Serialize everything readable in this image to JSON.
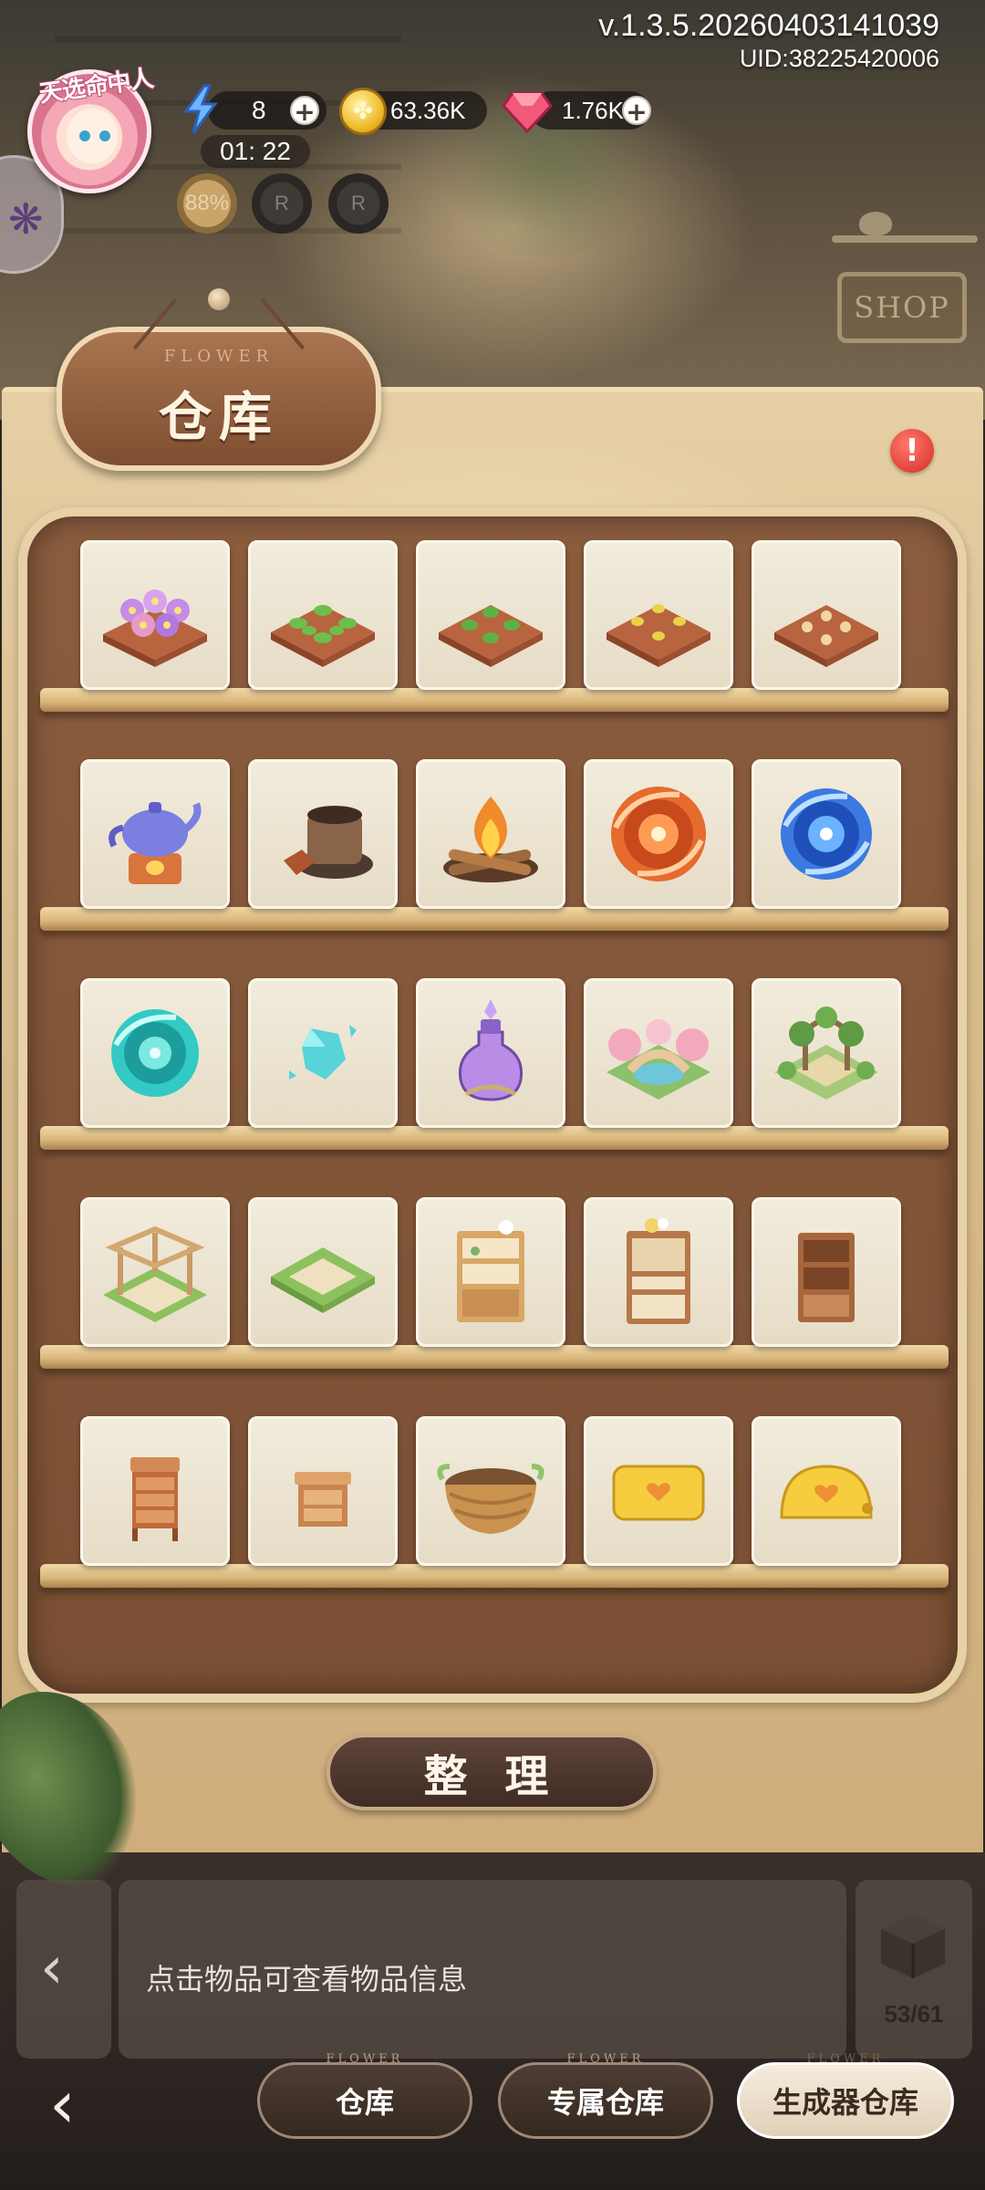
{
  "header": {
    "version": "v.1.3.5.20260403141039",
    "uid": "UID:38225420006",
    "avatar_badge": "天选命中人"
  },
  "resources": {
    "energy": "8",
    "energy_timer": "01: 22",
    "coins": "63.36K",
    "gems": "1.76K",
    "plus": "+"
  },
  "boosts": [
    "88%",
    "R",
    "R"
  ],
  "background": {
    "shop_sign": "SHOP"
  },
  "panel": {
    "subtitle": "FLOWER",
    "title": "仓库",
    "alert": "!"
  },
  "items": [
    "flower-bed-purple",
    "sprout-bed-large",
    "sprout-bed-medium",
    "seedling-bed",
    "seed-bed",
    "teapot-stove",
    "clay-pot-stove",
    "campfire",
    "orange-vortex",
    "blue-vortex",
    "teal-vortex",
    "crystal-shard",
    "purple-potion",
    "flower-bridge-garden",
    "rose-arch-garden",
    "wooden-pergola",
    "stone-patio-tile",
    "kitchen-shelf",
    "flower-cabinet",
    "bookcase",
    "small-drawer-chest",
    "wooden-stool",
    "woven-basket",
    "yellow-pouch",
    "yellow-coin-purse"
  ],
  "actions": {
    "sort_label": "整 理"
  },
  "info": {
    "hint": "点击物品可查看物品信息",
    "capacity": "53/61"
  },
  "tabs": {
    "sub": "FLOWER",
    "warehouse": "仓库",
    "exclusive": "专属仓库",
    "generator": "生成器仓库"
  }
}
